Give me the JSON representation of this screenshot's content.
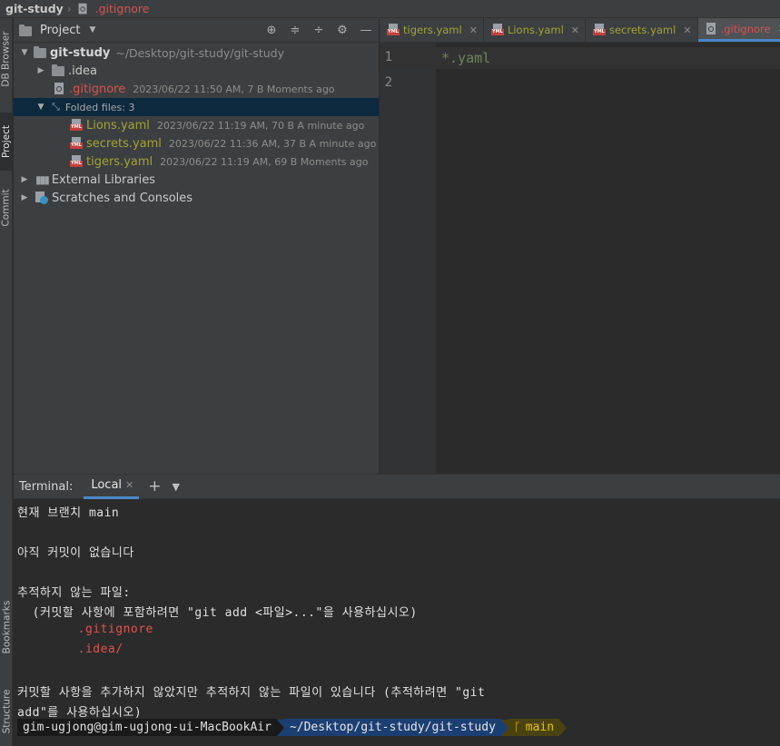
{
  "breadcrumb": {
    "project": "git-study",
    "file": ".gitignore"
  },
  "left_strip": {
    "db_browser": "DB Browser",
    "project": "Project",
    "commit": "Commit",
    "bookmarks": "Bookmarks",
    "structure": "Structure"
  },
  "project_panel": {
    "title": "Project",
    "root": {
      "name": "git-study",
      "path": "~/Desktop/git-study/git-study"
    },
    "idea": ".idea",
    "gitignore": {
      "name": ".gitignore",
      "meta": "2023/06/22 11:50 AM, 7 B Moments ago"
    },
    "folded": "Folded files: 3",
    "files": [
      {
        "name": "Lions.yaml",
        "meta": "2023/06/22 11:19 AM, 70 B A minute ago"
      },
      {
        "name": "secrets.yaml",
        "meta": "2023/06/22 11:36 AM, 37 B A minute ago"
      },
      {
        "name": "tigers.yaml",
        "meta": "2023/06/22 11:19 AM, 69 B Moments ago"
      }
    ],
    "external": "External Libraries",
    "scratches": "Scratches and Consoles",
    "icons": [
      "target-icon",
      "expand-all-icon",
      "collapse-all-icon",
      "gear-icon",
      "minimize-icon"
    ]
  },
  "editor": {
    "tabs": [
      {
        "label": "tigers.yaml",
        "color": "#a3a332"
      },
      {
        "label": "Lions.yaml",
        "color": "#a3a332"
      },
      {
        "label": "secrets.yaml",
        "color": "#a3a332"
      },
      {
        "label": ".gitignore",
        "color": "#d7524e"
      }
    ],
    "lines": [
      "1",
      "2"
    ],
    "code": "*.yaml"
  },
  "terminal": {
    "label": "Terminal:",
    "tab": "Local",
    "lines": [
      {
        "text": "현재 브랜치 main",
        "red": false
      },
      {
        "text": "",
        "red": false
      },
      {
        "text": "아직 커밋이 없습니다",
        "red": false
      },
      {
        "text": "",
        "red": false
      },
      {
        "text": "추적하지 않는 파일:",
        "red": false
      },
      {
        "text": "  (커밋할 사항에 포함하려면 \"git add <파일>...\"을 사용하십시오)",
        "red": false
      },
      {
        "text": "        .gitignore",
        "red": true
      },
      {
        "text": "        .idea/",
        "red": true
      },
      {
        "text": "",
        "red": false
      },
      {
        "text": "커밋할 사항을 추가하지 않았지만 추적하지 않는 파일이 있습니다 (추적하려면 \"git",
        "red": false
      },
      {
        "text": "add\"를 사용하십시오)",
        "red": false
      }
    ],
    "prompt": {
      "user": "gim-ugjong@gim-ugjong-ui-MacBookAir",
      "path": "~/Desktop/git-study/git-study",
      "branch": "main"
    }
  }
}
